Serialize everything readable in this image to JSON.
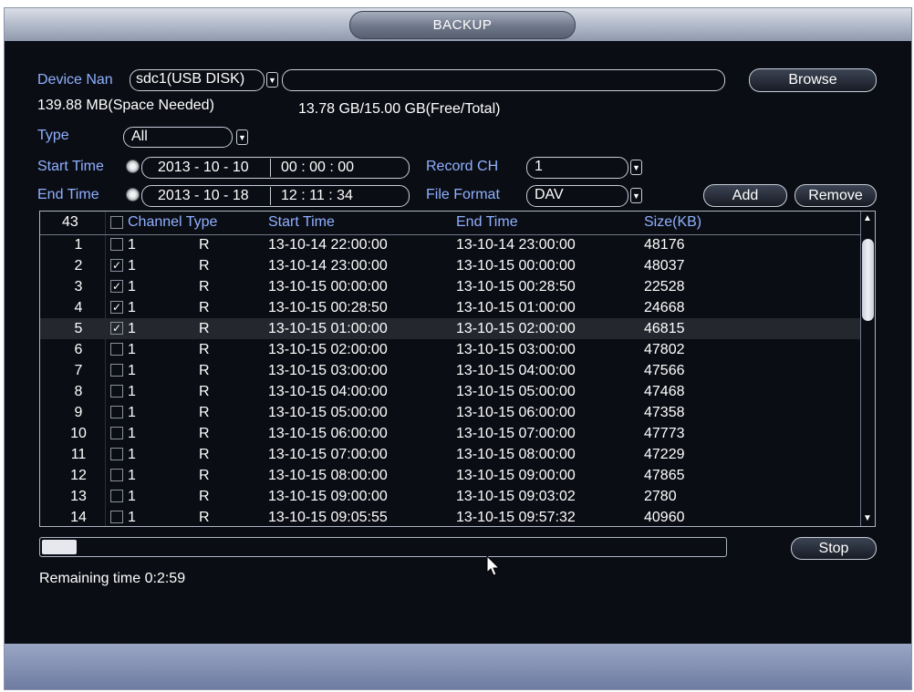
{
  "window": {
    "title": "BACKUP"
  },
  "device": {
    "label": "Device Nan",
    "selected": "sdc1(USB DISK)",
    "path_value": "",
    "browse_label": "Browse",
    "space_needed": "139.88 MB(Space Needed)",
    "free_total": "13.78 GB/15.00 GB(Free/Total)"
  },
  "filters": {
    "type_label": "Type",
    "type_value": "All",
    "start_label": "Start Time",
    "start_date": "2013 - 10 - 10",
    "start_time": "00 : 00 : 00",
    "end_label": "End Time",
    "end_date": "2013 - 10 - 18",
    "end_time": "12 : 11 : 34",
    "record_ch_label": "Record CH",
    "record_ch_value": "1",
    "file_format_label": "File Format",
    "file_format_value": "DAV",
    "add_label": "Add",
    "remove_label": "Remove"
  },
  "table": {
    "count": "43",
    "headers": {
      "channel_type": "Channel Type",
      "start": "Start Time",
      "end": "End Time",
      "size": "Size(KB)"
    },
    "rows": [
      {
        "no": "1",
        "checked": false,
        "ch": "1",
        "type": "R",
        "start": "13-10-14 22:00:00",
        "end": "13-10-14 23:00:00",
        "size": "48176"
      },
      {
        "no": "2",
        "checked": true,
        "ch": "1",
        "type": "R",
        "start": "13-10-14 23:00:00",
        "end": "13-10-15 00:00:00",
        "size": "48037"
      },
      {
        "no": "3",
        "checked": true,
        "ch": "1",
        "type": "R",
        "start": "13-10-15 00:00:00",
        "end": "13-10-15 00:28:50",
        "size": "22528"
      },
      {
        "no": "4",
        "checked": true,
        "ch": "1",
        "type": "R",
        "start": "13-10-15 00:28:50",
        "end": "13-10-15 01:00:00",
        "size": "24668"
      },
      {
        "no": "5",
        "checked": true,
        "ch": "1",
        "type": "R",
        "start": "13-10-15 01:00:00",
        "end": "13-10-15 02:00:00",
        "size": "46815",
        "selected": true
      },
      {
        "no": "6",
        "checked": false,
        "ch": "1",
        "type": "R",
        "start": "13-10-15 02:00:00",
        "end": "13-10-15 03:00:00",
        "size": "47802"
      },
      {
        "no": "7",
        "checked": false,
        "ch": "1",
        "type": "R",
        "start": "13-10-15 03:00:00",
        "end": "13-10-15 04:00:00",
        "size": "47566"
      },
      {
        "no": "8",
        "checked": false,
        "ch": "1",
        "type": "R",
        "start": "13-10-15 04:00:00",
        "end": "13-10-15 05:00:00",
        "size": "47468"
      },
      {
        "no": "9",
        "checked": false,
        "ch": "1",
        "type": "R",
        "start": "13-10-15 05:00:00",
        "end": "13-10-15 06:00:00",
        "size": "47358"
      },
      {
        "no": "10",
        "checked": false,
        "ch": "1",
        "type": "R",
        "start": "13-10-15 06:00:00",
        "end": "13-10-15 07:00:00",
        "size": "47773"
      },
      {
        "no": "11",
        "checked": false,
        "ch": "1",
        "type": "R",
        "start": "13-10-15 07:00:00",
        "end": "13-10-15 08:00:00",
        "size": "47229"
      },
      {
        "no": "12",
        "checked": false,
        "ch": "1",
        "type": "R",
        "start": "13-10-15 08:00:00",
        "end": "13-10-15 09:00:00",
        "size": "47865"
      },
      {
        "no": "13",
        "checked": false,
        "ch": "1",
        "type": "R",
        "start": "13-10-15 09:00:00",
        "end": "13-10-15 09:03:02",
        "size": "2780"
      },
      {
        "no": "14",
        "checked": false,
        "ch": "1",
        "type": "R",
        "start": "13-10-15 09:05:55",
        "end": "13-10-15 09:57:32",
        "size": "40960"
      }
    ]
  },
  "progress": {
    "fraction": 0.05,
    "stop_label": "Stop",
    "remaining": "Remaining time 0:2:59"
  },
  "colors": {
    "label_blue": "#8fb0ff",
    "background": "#0b0d14",
    "selected_row": "#24272e"
  }
}
